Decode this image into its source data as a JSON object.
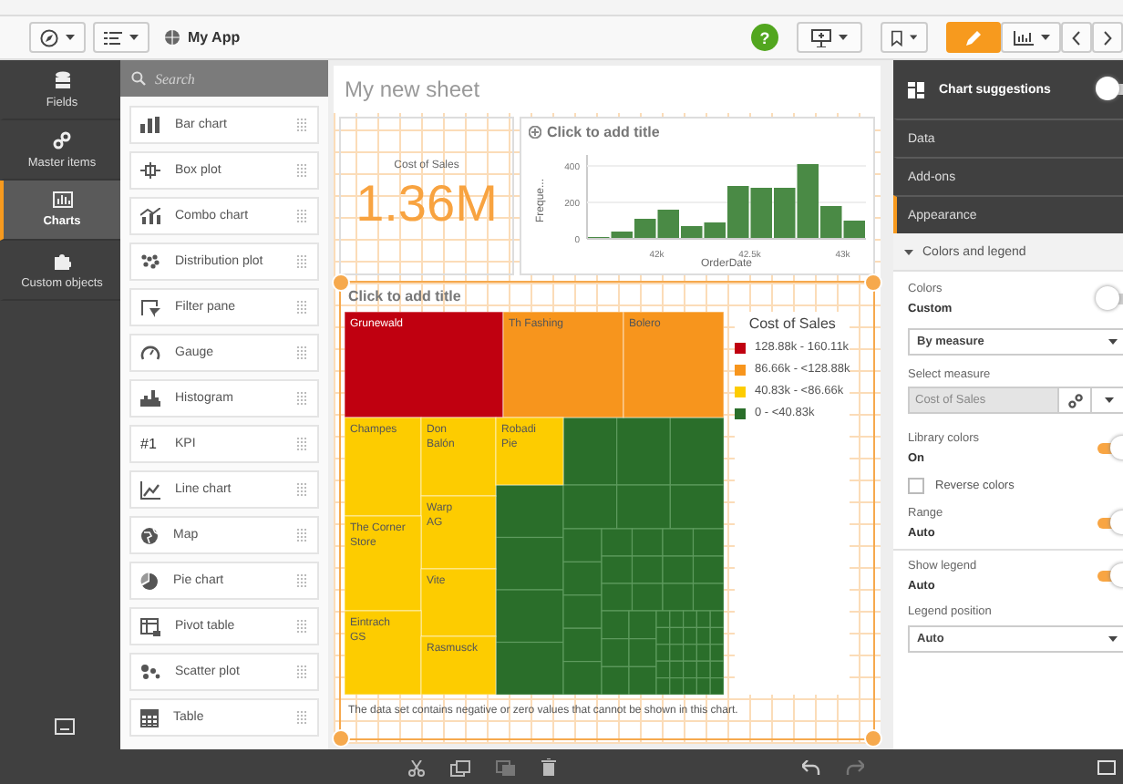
{
  "toolbar": {
    "app_name": "My App",
    "help": "?",
    "edit_selected": true
  },
  "nav": [
    {
      "label": "Fields",
      "kind": "database",
      "selected": false
    },
    {
      "label": "Master items",
      "kind": "link",
      "selected": false
    },
    {
      "label": "Charts",
      "kind": "chart",
      "selected": true
    },
    {
      "label": "Custom objects",
      "kind": "puzzle",
      "selected": false
    }
  ],
  "assets": {
    "search": {
      "placeholder": "Search"
    },
    "items": [
      {
        "label": "Bar chart",
        "kind": "bar"
      },
      {
        "label": "Box plot",
        "kind": "box"
      },
      {
        "label": "Combo chart",
        "kind": "combo"
      },
      {
        "label": "Distribution plot",
        "kind": "distribution"
      },
      {
        "label": "Filter pane",
        "kind": "filter"
      },
      {
        "label": "Gauge",
        "kind": "gauge"
      },
      {
        "label": "Histogram",
        "kind": "histogram"
      },
      {
        "label": "KPI",
        "kind": "text",
        "icon_text": "#1"
      },
      {
        "label": "Line chart",
        "kind": "line"
      },
      {
        "label": "Map",
        "kind": "globe"
      },
      {
        "label": "Pie chart",
        "kind": "pie"
      },
      {
        "label": "Pivot table",
        "kind": "pivot"
      },
      {
        "label": "Scatter plot",
        "kind": "scatter"
      },
      {
        "label": "Table",
        "kind": "table"
      }
    ]
  },
  "sheet": {
    "title": "My new sheet",
    "kpi": {
      "label": "Cost of Sales",
      "value": "1.36M"
    },
    "histogram": {
      "title": "Click to add title",
      "chart_data": {
        "type": "bar",
        "xlabel": "OrderDate",
        "ylabel": "Freque...",
        "x": [
          41687.5,
          41812.5,
          41937.5,
          42062.5,
          42187.5,
          42312.5,
          42437.5,
          42562.5,
          42687.5,
          42812.5,
          42937.5,
          43062.5
        ],
        "values": [
          10,
          40,
          110,
          160,
          70,
          90,
          290,
          280,
          280,
          410,
          180,
          100
        ],
        "xlim": [
          41625,
          43125
        ],
        "ylim": [
          0,
          420
        ],
        "yticks": [
          0,
          200,
          400
        ],
        "xticks": [
          {
            "value": 42000,
            "label": "42k"
          },
          {
            "value": 42500,
            "label": "42.5k"
          },
          {
            "value": 43000,
            "label": "43k"
          }
        ],
        "color": "#4a8a45"
      }
    },
    "treemap": {
      "title": "Click to add title",
      "selected": true,
      "tiles": [
        {
          "label": "Grunewald",
          "color": "#c00010"
        },
        {
          "label": "Th Fashing",
          "color": "#f7951d"
        },
        {
          "label": "Bolero",
          "color": "#f7951d"
        },
        {
          "label": "Champes",
          "color": "#fdcc00"
        },
        {
          "label": "Don Balón",
          "color": "#fdcc00"
        },
        {
          "label": "Robadi Pie",
          "color": "#fdcc00"
        },
        {
          "label": "Warp AG",
          "color": "#fdcc00"
        },
        {
          "label": "The Corner Store",
          "color": "#fdcc00"
        },
        {
          "label": "Vite",
          "color": "#fdcc00"
        },
        {
          "label": "Eintrach GS",
          "color": "#fdcc00"
        },
        {
          "label": "Rasmusck",
          "color": "#fdcc00"
        }
      ],
      "legend": {
        "title": "Cost of Sales",
        "items": [
          {
            "label": "128.88k - 160.11k",
            "color": "#c00010"
          },
          {
            "label": "86.66k - <128.88k",
            "color": "#f7951d"
          },
          {
            "label": "40.83k - <86.66k",
            "color": "#fdcc00"
          },
          {
            "label": "0 - <40.83k",
            "color": "#2a6e2a"
          }
        ]
      },
      "note": "The data set contains negative or zero values that cannot be shown in this chart."
    }
  },
  "properties": {
    "header": {
      "label": "Chart suggestions",
      "on": false
    },
    "sections": [
      {
        "label": "Data",
        "selected": false
      },
      {
        "label": "Add-ons",
        "selected": false
      },
      {
        "label": "Appearance",
        "selected": true
      }
    ],
    "group": {
      "label": "Colors and legend",
      "expanded": true
    },
    "colors": {
      "label": "Colors",
      "value": "Custom",
      "on": false
    },
    "color_mode": {
      "value": "By measure"
    },
    "select_measure": {
      "label": "Select measure",
      "value": "Cost of Sales",
      "disabled": true
    },
    "library_colors": {
      "label": "Library colors",
      "value": "On",
      "on": true
    },
    "reverse_colors": {
      "label": "Reverse colors",
      "checked": false
    },
    "range": {
      "label": "Range",
      "value": "Auto",
      "on": true
    },
    "show_legend": {
      "label": "Show legend",
      "value": "Auto",
      "on": true
    },
    "legend_position": {
      "label": "Legend position",
      "value": "Auto"
    }
  }
}
